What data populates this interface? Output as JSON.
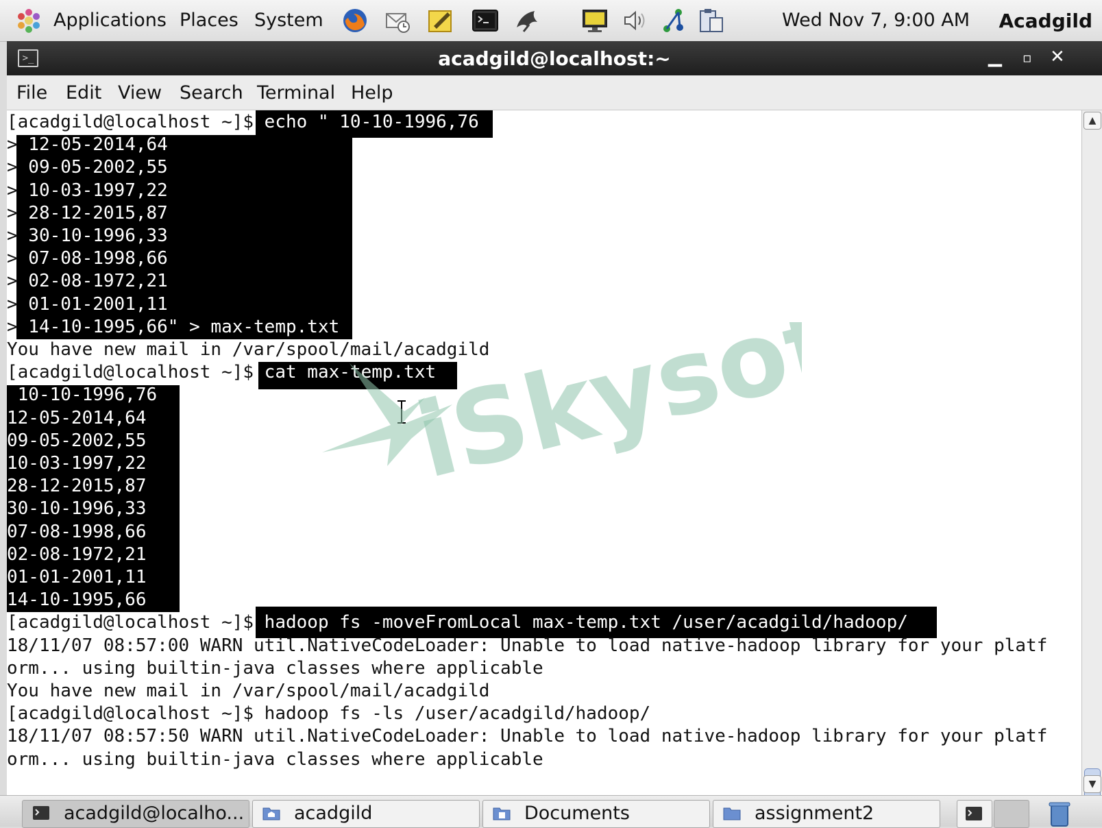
{
  "panel": {
    "menus": [
      "Applications",
      "Places",
      "System"
    ],
    "clock": "Wed Nov  7,  9:00 AM",
    "user": "Acadgild"
  },
  "window": {
    "title": "acadgild@localhost:~",
    "menu": [
      "File",
      "Edit",
      "View",
      "Search",
      "Terminal",
      "Help"
    ]
  },
  "terminal": {
    "lines": [
      {
        "prompt": "[acadgild@localhost ~]$",
        "text": " echo \" 10-10-1996,76"
      },
      {
        "prompt": ">",
        "text": " 12-05-2014,64"
      },
      {
        "prompt": ">",
        "text": " 09-05-2002,55"
      },
      {
        "prompt": ">",
        "text": " 10-03-1997,22"
      },
      {
        "prompt": ">",
        "text": " 28-12-2015,87"
      },
      {
        "prompt": ">",
        "text": " 30-10-1996,33"
      },
      {
        "prompt": ">",
        "text": " 07-08-1998,66"
      },
      {
        "prompt": ">",
        "text": " 02-08-1972,21"
      },
      {
        "prompt": ">",
        "text": " 01-01-2001,11"
      },
      {
        "prompt": ">",
        "text": " 14-10-1995,66\" > max-temp.txt"
      },
      {
        "prompt": "",
        "text": "You have new mail in /var/spool/mail/acadgild"
      },
      {
        "prompt": "[acadgild@localhost ~]$",
        "text": " cat max-temp.txt"
      },
      {
        "prompt": "",
        "text": " 10-10-1996,76"
      },
      {
        "prompt": "",
        "text": "12-05-2014,64"
      },
      {
        "prompt": "",
        "text": "09-05-2002,55"
      },
      {
        "prompt": "",
        "text": "10-03-1997,22"
      },
      {
        "prompt": "",
        "text": "28-12-2015,87"
      },
      {
        "prompt": "",
        "text": "30-10-1996,33"
      },
      {
        "prompt": "",
        "text": "07-08-1998,66"
      },
      {
        "prompt": "",
        "text": "02-08-1972,21"
      },
      {
        "prompt": "",
        "text": "01-01-2001,11"
      },
      {
        "prompt": "",
        "text": "14-10-1995,66"
      },
      {
        "prompt": "[acadgild@localhost ~]$",
        "text": " hadoop fs -moveFromLocal max-temp.txt /user/acadgild/hadoop/"
      },
      {
        "prompt": "",
        "text": "18/11/07 08:57:00 WARN util.NativeCodeLoader: Unable to load native-hadoop library for your platf"
      },
      {
        "prompt": "",
        "text": "orm... using builtin-java classes where applicable"
      },
      {
        "prompt": "",
        "text": "You have new mail in /var/spool/mail/acadgild"
      },
      {
        "prompt": "[acadgild@localhost ~]$",
        "text": " hadoop fs -ls /user/acadgild/hadoop/"
      },
      {
        "prompt": "",
        "text": "18/11/07 08:57:50 WARN util.NativeCodeLoader: Unable to load native-hadoop library for your platf"
      },
      {
        "prompt": "",
        "text": "orm... using builtin-java classes where applicable"
      }
    ]
  },
  "watermark": "iSkysoft",
  "taskbar": {
    "tasks": [
      {
        "label": "acadgild@localho...",
        "icon": "terminal-icon"
      },
      {
        "label": "acadgild",
        "icon": "home-folder-icon"
      },
      {
        "label": "Documents",
        "icon": "documents-folder-icon"
      },
      {
        "label": "assignment2",
        "icon": "folder-icon"
      }
    ]
  },
  "colors": {
    "terminal_bg": "#ffffff",
    "selection_bg": "#000000",
    "titlebar": "#2a2a2a",
    "watermark": "#8fc4ac"
  }
}
